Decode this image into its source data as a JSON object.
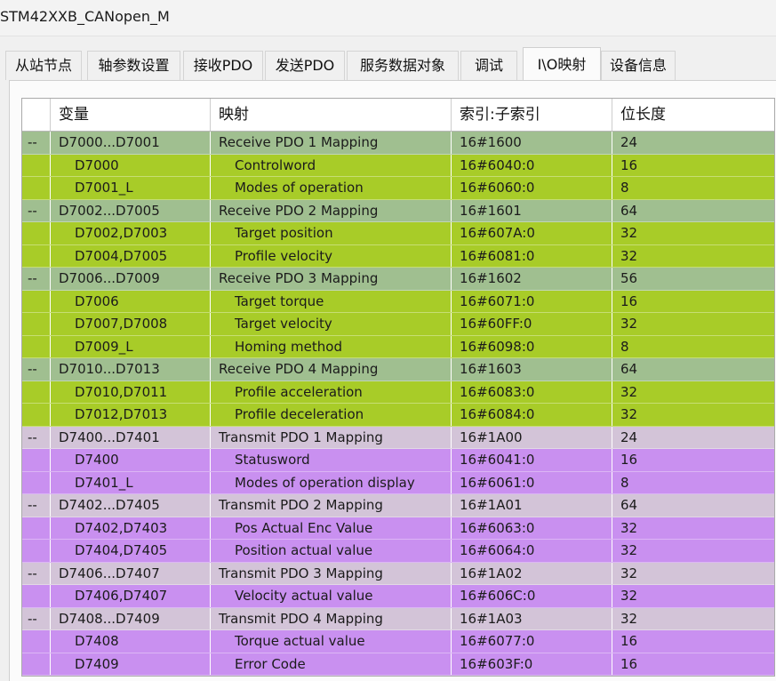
{
  "window": {
    "title": "STM42XXB_CANopen_M"
  },
  "tabs": [
    {
      "label": "从站节点"
    },
    {
      "label": "轴参数设置"
    },
    {
      "label": "接收PDO"
    },
    {
      "label": "发送PDO"
    },
    {
      "label": "服务数据对象"
    },
    {
      "label": "调试"
    },
    {
      "label": "I\\O映射"
    },
    {
      "label": "设备信息"
    }
  ],
  "table": {
    "headers": [
      "",
      "变量",
      "映射",
      "索引:子索引",
      "位长度"
    ],
    "colors": {
      "rx_group": "#a0bf90",
      "rx_item": "#a8cc28",
      "tx_group": "#d3c4d8",
      "tx_item": "#c990f0"
    },
    "rows": [
      {
        "kind": "rx_group",
        "toggle": "--",
        "var": "D7000...D7001",
        "map": "Receive PDO 1 Mapping",
        "index": "16#1600",
        "len": "24"
      },
      {
        "kind": "rx_item",
        "toggle": "",
        "var": "D7000",
        "map": "Controlword",
        "index": "16#6040:0",
        "len": "16"
      },
      {
        "kind": "rx_item",
        "toggle": "",
        "var": "D7001_L",
        "map": "Modes of operation",
        "index": "16#6060:0",
        "len": "8"
      },
      {
        "kind": "rx_group",
        "toggle": "--",
        "var": "D7002...D7005",
        "map": "Receive PDO 2 Mapping",
        "index": "16#1601",
        "len": "64"
      },
      {
        "kind": "rx_item",
        "toggle": "",
        "var": "D7002,D7003",
        "map": "Target position",
        "index": "16#607A:0",
        "len": "32"
      },
      {
        "kind": "rx_item",
        "toggle": "",
        "var": "D7004,D7005",
        "map": "Profile velocity",
        "index": "16#6081:0",
        "len": "32"
      },
      {
        "kind": "rx_group",
        "toggle": "--",
        "var": "D7006...D7009",
        "map": "Receive PDO 3 Mapping",
        "index": "16#1602",
        "len": "56"
      },
      {
        "kind": "rx_item",
        "toggle": "",
        "var": "D7006",
        "map": "Target torque",
        "index": "16#6071:0",
        "len": "16"
      },
      {
        "kind": "rx_item",
        "toggle": "",
        "var": "D7007,D7008",
        "map": "Target velocity",
        "index": "16#60FF:0",
        "len": "32"
      },
      {
        "kind": "rx_item",
        "toggle": "",
        "var": "D7009_L",
        "map": "Homing method",
        "index": "16#6098:0",
        "len": "8"
      },
      {
        "kind": "rx_group",
        "toggle": "--",
        "var": "D7010...D7013",
        "map": "Receive PDO 4 Mapping",
        "index": "16#1603",
        "len": "64"
      },
      {
        "kind": "rx_item",
        "toggle": "",
        "var": "D7010,D7011",
        "map": "Profile acceleration",
        "index": "16#6083:0",
        "len": "32"
      },
      {
        "kind": "rx_item",
        "toggle": "",
        "var": "D7012,D7013",
        "map": "Profile deceleration",
        "index": "16#6084:0",
        "len": "32"
      },
      {
        "kind": "tx_group",
        "toggle": "--",
        "var": "D7400...D7401",
        "map": "Transmit PDO 1 Mapping",
        "index": "16#1A00",
        "len": "24"
      },
      {
        "kind": "tx_item",
        "toggle": "",
        "var": "D7400",
        "map": "Statusword",
        "index": "16#6041:0",
        "len": "16"
      },
      {
        "kind": "tx_item",
        "toggle": "",
        "var": "D7401_L",
        "map": "Modes of operation display",
        "index": "16#6061:0",
        "len": "8"
      },
      {
        "kind": "tx_group",
        "toggle": "--",
        "var": "D7402...D7405",
        "map": "Transmit PDO 2 Mapping",
        "index": "16#1A01",
        "len": "64"
      },
      {
        "kind": "tx_item",
        "toggle": "",
        "var": "D7402,D7403",
        "map": "Pos Actual Enc Value",
        "index": "16#6063:0",
        "len": "32"
      },
      {
        "kind": "tx_item",
        "toggle": "",
        "var": "D7404,D7405",
        "map": "Position actual value",
        "index": "16#6064:0",
        "len": "32"
      },
      {
        "kind": "tx_group",
        "toggle": "--",
        "var": "D7406...D7407",
        "map": "Transmit PDO 3 Mapping",
        "index": "16#1A02",
        "len": "32"
      },
      {
        "kind": "tx_item",
        "toggle": "",
        "var": "D7406,D7407",
        "map": "Velocity actual value",
        "index": "16#606C:0",
        "len": "32"
      },
      {
        "kind": "tx_group",
        "toggle": "--",
        "var": "D7408...D7409",
        "map": "Transmit PDO 4 Mapping",
        "index": "16#1A03",
        "len": "32"
      },
      {
        "kind": "tx_item",
        "toggle": "",
        "var": "D7408",
        "map": "Torque actual value",
        "index": "16#6077:0",
        "len": "16"
      },
      {
        "kind": "tx_item",
        "toggle": "",
        "var": "D7409",
        "map": "Error Code",
        "index": "16#603F:0",
        "len": "16"
      }
    ]
  }
}
